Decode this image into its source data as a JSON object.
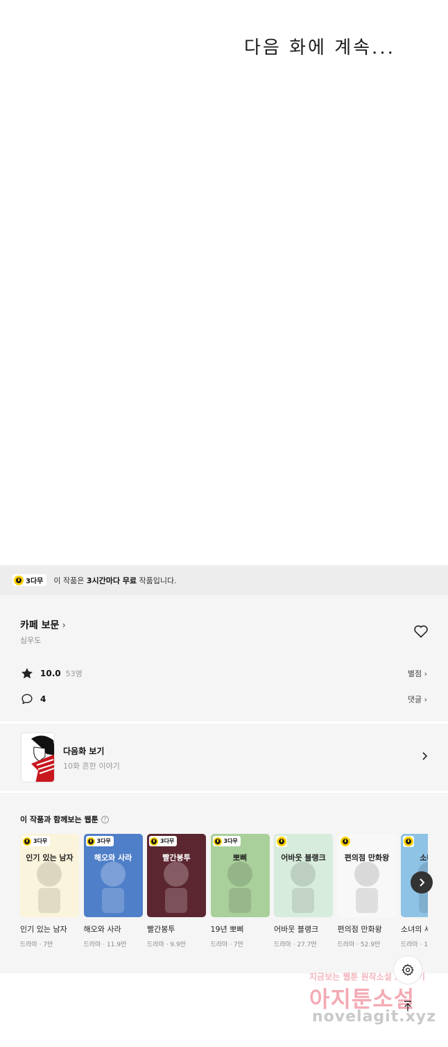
{
  "comic": {
    "panel_text": "다음 화에 계속..."
  },
  "free_banner": {
    "badge": "3다무",
    "text_prefix": "이 작품은 ",
    "text_bold": "3시간마다 무료",
    "text_suffix": " 작품입니다."
  },
  "work": {
    "title": "카페 보문",
    "author": "심우도",
    "rating": "10.0",
    "rating_count": "53명",
    "rating_link": "별점",
    "comment_count": "4",
    "comment_link": "댓글"
  },
  "next_episode": {
    "label": "다음화 보기",
    "subtitle": "10화 흔한 이야기"
  },
  "recommendations": {
    "title": "이 작품과 함께보는 웹툰",
    "help": "?",
    "items": [
      {
        "name": "인기 있는 남자",
        "meta": "드라마 · 7만",
        "badge": "3다무",
        "bg": "#fbf4dc",
        "art": "인기 있는 남자"
      },
      {
        "name": "해오와 사라",
        "meta": "드라마 · 11.9만",
        "badge": "3다무",
        "bg": "#4f7fc9",
        "art": "해오와 사라"
      },
      {
        "name": "빨간봉투",
        "meta": "드라마 · 9.9만",
        "badge": "3다무",
        "bg": "#5c2630",
        "art": "빨간봉투"
      },
      {
        "name": "19년 뽀삐",
        "meta": "드라마 · 7만",
        "badge": "3다무",
        "bg": "#a9cf9a",
        "art": "뽀삐"
      },
      {
        "name": "어바웃 블랭크",
        "meta": "드라마 · 27.7만",
        "badge": "",
        "bg": "#d7ecdc",
        "art": "어바웃 블랭크"
      },
      {
        "name": "편의점 만화왕",
        "meta": "드라마 · 52.9만",
        "badge": "",
        "bg": "#f8f8f8",
        "art": "편의점 만화왕"
      },
      {
        "name": "소녀의 세계",
        "meta": "드라마 · 1",
        "badge": "",
        "bg": "#8ec3e6",
        "art": "소녀의"
      }
    ]
  },
  "watermark": {
    "line1": "지금보는 웹툰 원작소설 보러가기",
    "line2": "아지툰소설",
    "line3": "novelagit.xyz"
  },
  "colors": {
    "accent_yellow": "#ffd200",
    "panel_bg": "#f5f5f5",
    "banner_bg": "#ededed"
  },
  "icons": [
    "clock-icon",
    "heart-icon",
    "star-icon",
    "comment-icon",
    "chevron-right-icon",
    "gear-icon",
    "arrow-up-icon"
  ]
}
